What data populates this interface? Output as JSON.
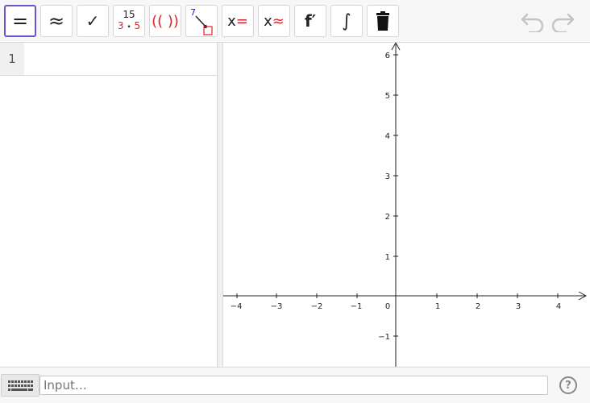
{
  "toolbar": {
    "evaluate": "=",
    "numeric": "≈",
    "check": "✓",
    "factor_top": "15",
    "factor_left": "3",
    "factor_dot": "•",
    "factor_right": "5",
    "expand": "(( ))",
    "substitute_digit": "7",
    "solve_x": "x",
    "solve_eq": "=",
    "nsolve_x": "x",
    "nsolve_eq": "≈",
    "derivative": "f′",
    "integral": "∫"
  },
  "cas": {
    "rows": [
      {
        "number": "1",
        "value": ""
      }
    ]
  },
  "graphics": {
    "x_ticks": [
      "−4",
      "−3",
      "−2",
      "−1",
      "0",
      "1",
      "2",
      "3",
      "4"
    ],
    "y_ticks": [
      "6",
      "5",
      "4",
      "3",
      "2",
      "1",
      "−1"
    ]
  },
  "inputbar": {
    "placeholder": "Input…",
    "help": "?"
  },
  "colors": {
    "accent": "#6557d2",
    "red": "#e0202a",
    "blue": "#1a1ae0"
  }
}
